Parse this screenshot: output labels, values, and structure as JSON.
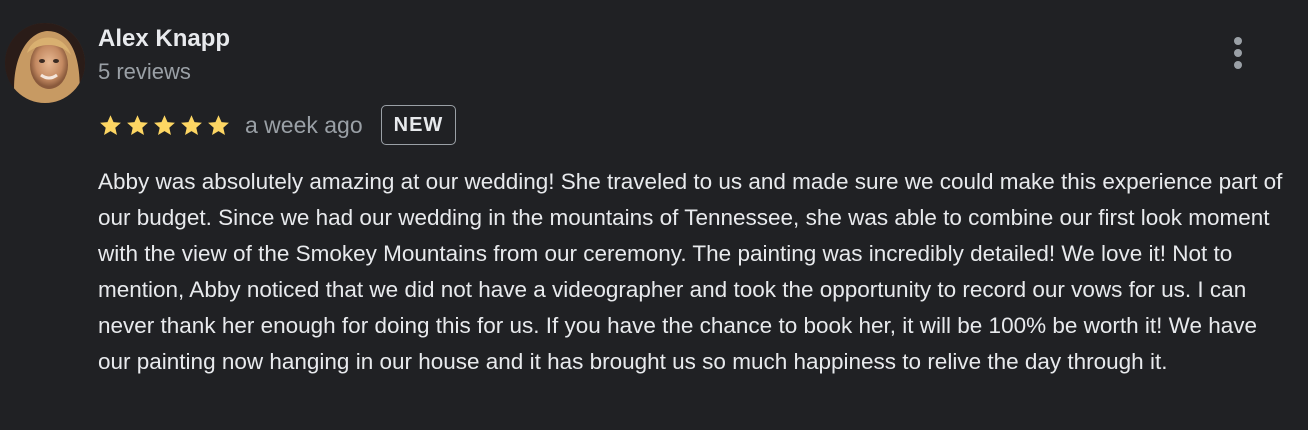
{
  "review": {
    "author_name": "Alex Knapp",
    "author_reviews": "5 reviews",
    "rating": 5,
    "rating_max": 5,
    "date": "a week ago",
    "badge": "NEW",
    "text": "Abby was absolutely amazing at our wedding! She traveled to us and made sure we could make this experience part of our budget. Since we had our wedding in the mountains of Tennessee, she was able to combine our first look moment with the view of the Smokey Mountains from our ceremony. The painting was incredibly detailed! We love it! Not to mention, Abby noticed that we did not have a videographer and took the opportunity to record our vows for us. I can never thank her enough for doing this for us. If you have the chance to book her, it will be 100% be worth it! We have our painting now hanging in our house and it has brought us so much happiness to relive the day through it."
  },
  "icons": {
    "menu": "more-vertical-icon",
    "star": "star-icon"
  },
  "colors": {
    "background": "#202124",
    "text_primary": "#e8eaed",
    "text_secondary": "#9aa0a6",
    "star": "#fdd663"
  }
}
